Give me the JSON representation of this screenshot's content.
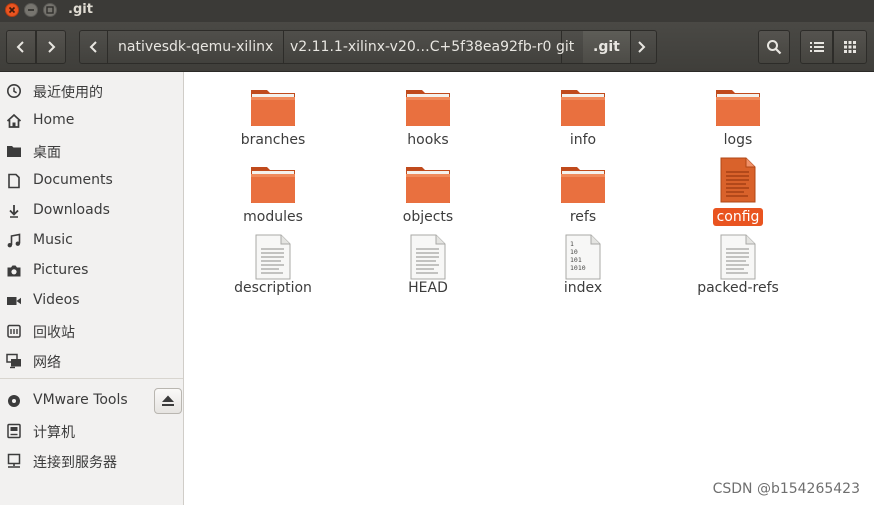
{
  "window": {
    "title": ".git"
  },
  "toolbar": {
    "crumbs": [
      "nativesdk-qemu-xilinx",
      "v2.11.1-xilinx-v20…C+5f38ea92fb-r0",
      "git",
      ".git"
    ]
  },
  "sidebar": {
    "items": [
      {
        "label": "最近使用的",
        "icon": "clock-icon"
      },
      {
        "label": "Home",
        "icon": "home-icon"
      },
      {
        "label": "桌面",
        "icon": "folder-icon"
      },
      {
        "label": "Documents",
        "icon": "document-icon"
      },
      {
        "label": "Downloads",
        "icon": "download-icon"
      },
      {
        "label": "Music",
        "icon": "music-icon"
      },
      {
        "label": "Pictures",
        "icon": "camera-icon"
      },
      {
        "label": "Videos",
        "icon": "video-icon"
      },
      {
        "label": "回收站",
        "icon": "trash-icon"
      },
      {
        "label": "网络",
        "icon": "network-icon"
      },
      {
        "label": "VMware Tools",
        "icon": "disc-icon"
      },
      {
        "label": "计算机",
        "icon": "computer-icon"
      },
      {
        "label": "连接到服务器",
        "icon": "server-icon"
      }
    ]
  },
  "files": [
    {
      "name": "branches",
      "type": "folder"
    },
    {
      "name": "hooks",
      "type": "folder"
    },
    {
      "name": "info",
      "type": "folder"
    },
    {
      "name": "logs",
      "type": "folder"
    },
    {
      "name": "modules",
      "type": "folder"
    },
    {
      "name": "objects",
      "type": "folder"
    },
    {
      "name": "refs",
      "type": "folder"
    },
    {
      "name": "config",
      "type": "text-file",
      "selected": true
    },
    {
      "name": "description",
      "type": "text-file"
    },
    {
      "name": "HEAD",
      "type": "text-file"
    },
    {
      "name": "index",
      "type": "binary-file",
      "binary_lines": [
        "1",
        "10",
        "101",
        "1010"
      ]
    },
    {
      "name": "packed-refs",
      "type": "text-file"
    }
  ],
  "watermark": "CSDN @b154265423",
  "colors": {
    "accent": "#e95420",
    "folder": "#e9703f",
    "titlebar": "#3b3a37"
  }
}
